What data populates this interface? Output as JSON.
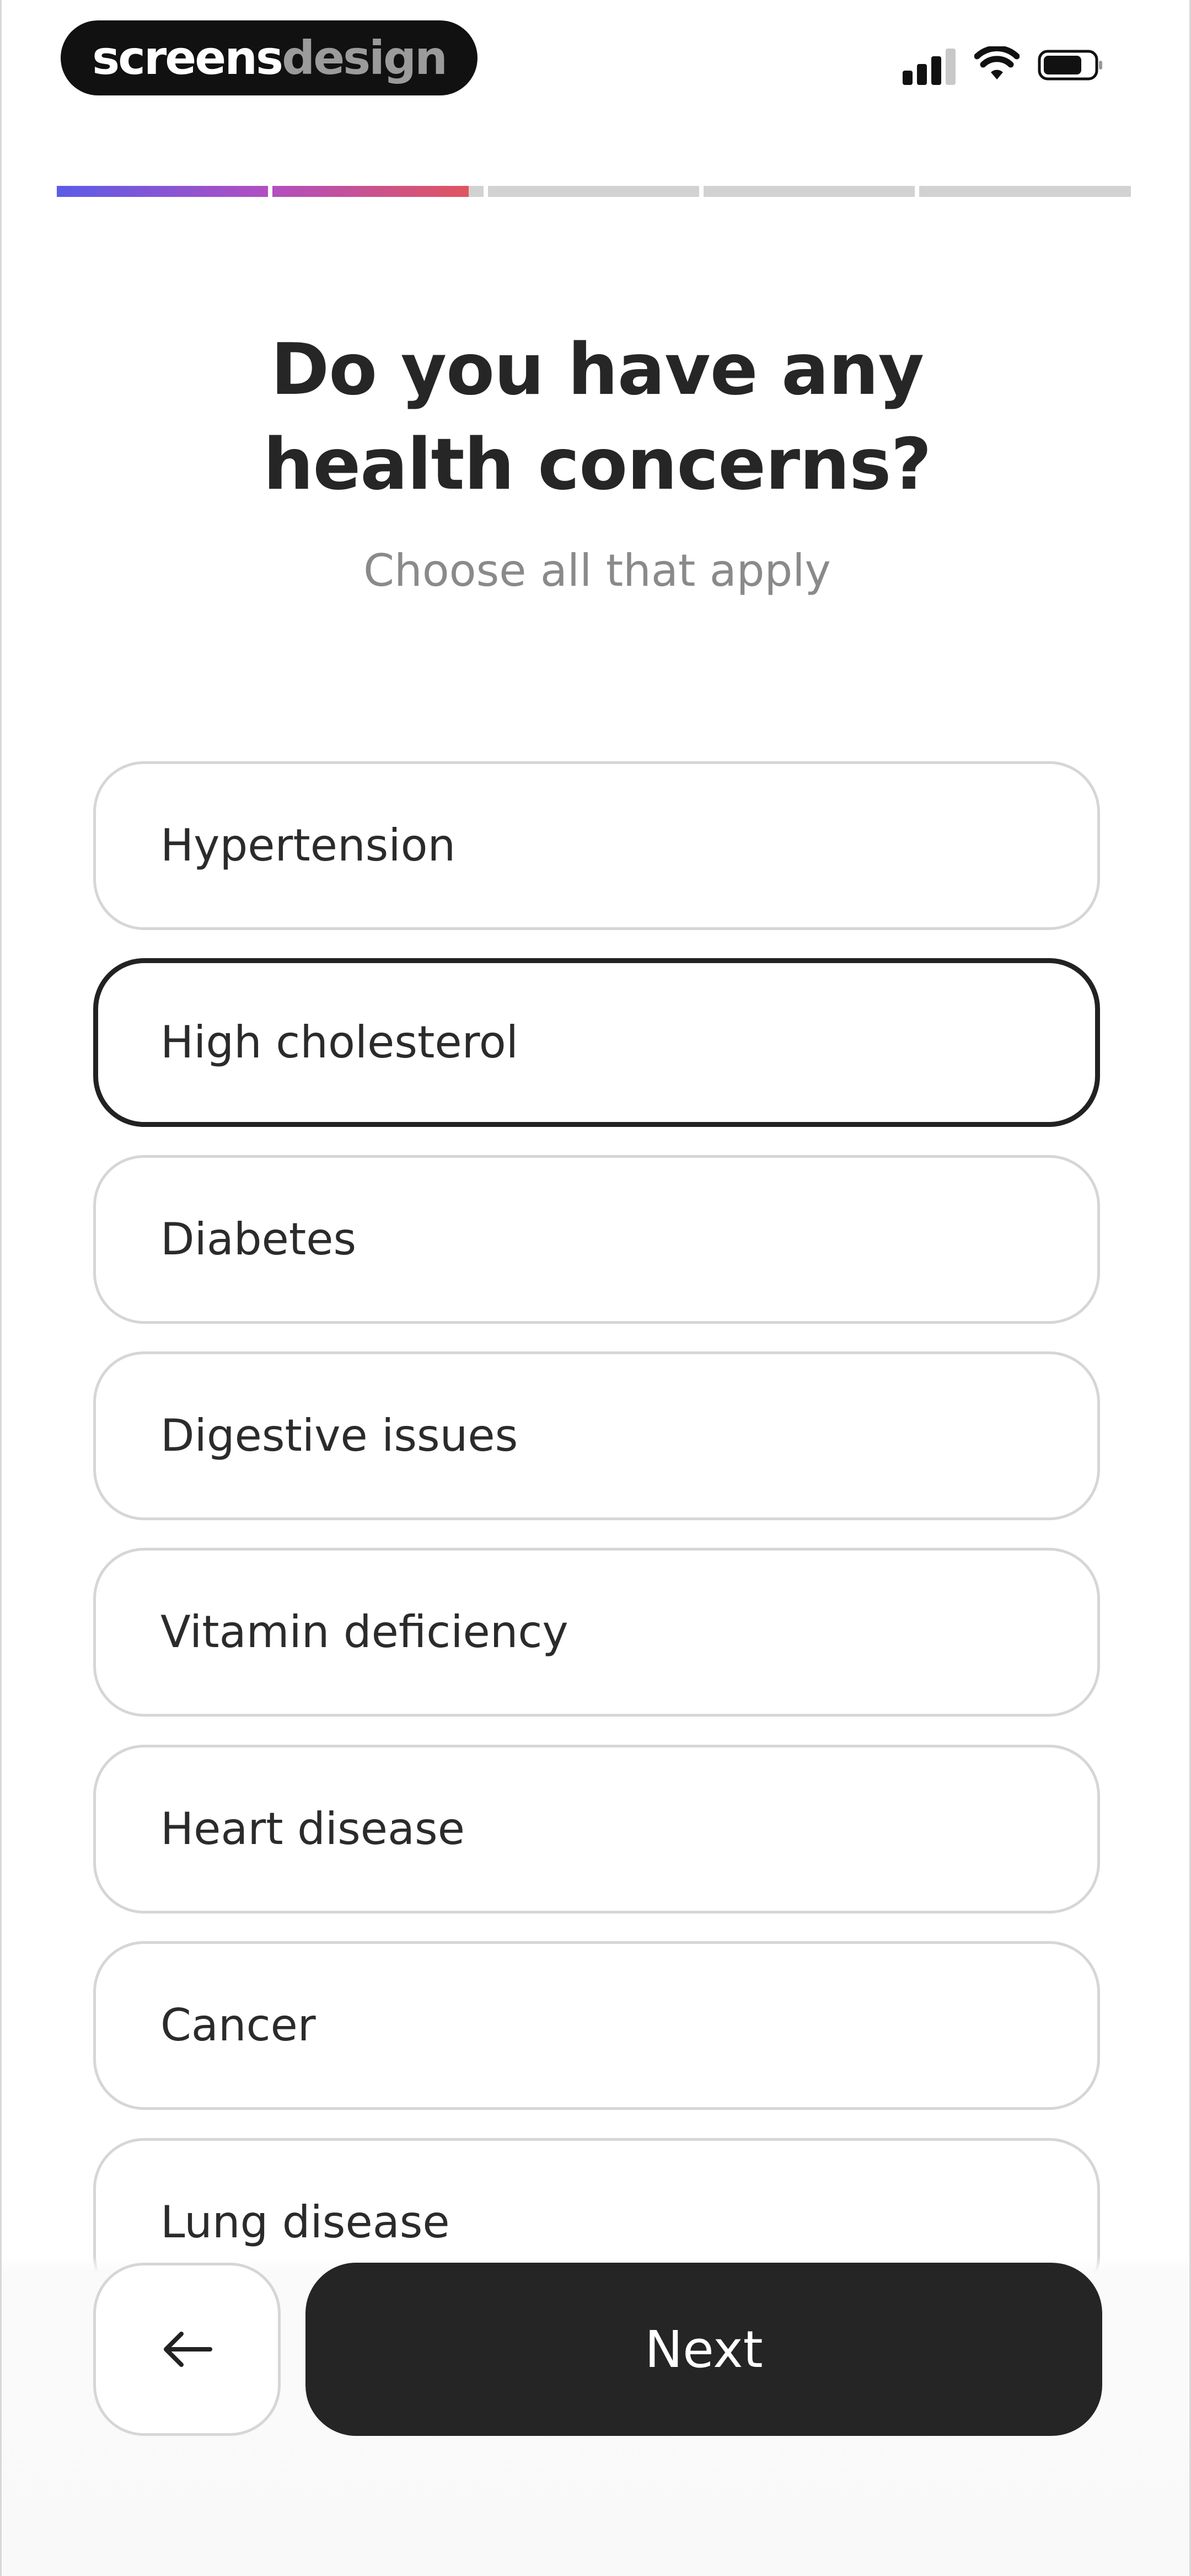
{
  "brand": {
    "logo_part1": "screens",
    "logo_part2": "design"
  },
  "status_bar": {
    "signal_icon": "cellular-signal-icon",
    "wifi_icon": "wifi-icon",
    "battery_icon": "battery-icon"
  },
  "progress": {
    "total_steps": 5,
    "segments": [
      1.0,
      0.93,
      0.0,
      0.0,
      0.0
    ],
    "colors": {
      "gradient_start": "#5b5ce8",
      "gradient_mid": "#b24fc0",
      "gradient_end": "#e0555f",
      "track": "#d2d2d2"
    }
  },
  "question": {
    "title_line1": "Do you have any",
    "title_line2": "health concerns?",
    "subtitle": "Choose all that apply"
  },
  "options": [
    {
      "label": "Hypertension",
      "selected": false
    },
    {
      "label": "High cholesterol",
      "selected": true
    },
    {
      "label": "Diabetes",
      "selected": false
    },
    {
      "label": "Digestive issues",
      "selected": false
    },
    {
      "label": "Vitamin deficiency",
      "selected": false
    },
    {
      "label": "Heart disease",
      "selected": false
    },
    {
      "label": "Cancer",
      "selected": false
    },
    {
      "label": "Lung disease",
      "selected": false
    }
  ],
  "footer": {
    "back_icon": "arrow-left-icon",
    "next_label": "Next"
  }
}
